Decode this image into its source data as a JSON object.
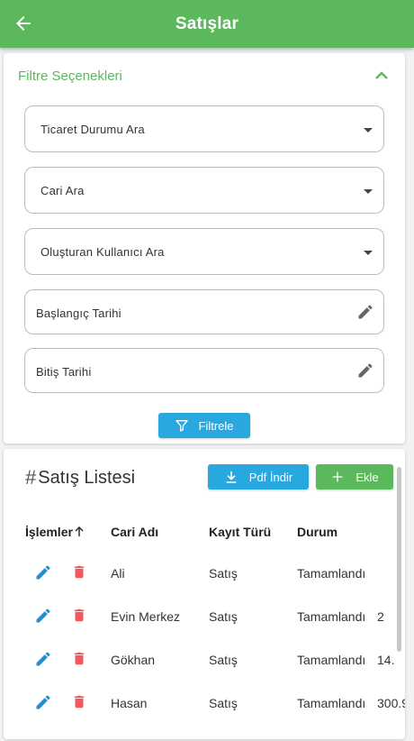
{
  "header": {
    "title": "Satışlar",
    "back_icon": "arrow-left-icon"
  },
  "filter": {
    "title": "Filtre Seçenekleri",
    "trade_status_label": "Ticaret Durumu Ara",
    "account_label": "Cari Ara",
    "created_by_label": "Oluşturan Kullanıcı Ara",
    "start_date_label": "Başlangıç Tarihi",
    "end_date_label": "Bitiş Tarihi",
    "filter_button_label": "Filtrele"
  },
  "list": {
    "hash": "#",
    "title": "Satış Listesi",
    "pdf_button_label": "Pdf İndir",
    "add_button_label": "Ekle",
    "columns": [
      "İşlemler",
      "Cari Adı",
      "Kayıt Türü",
      "Durum"
    ],
    "rows": [
      {
        "name": "Ali",
        "type": "Satış",
        "status": "Tamamlandı",
        "amount": ""
      },
      {
        "name": "Evin  Merkez",
        "type": "Satış",
        "status": "Tamamlandı",
        "amount": "2"
      },
      {
        "name": "Gökhan",
        "type": "Satış",
        "status": "Tamamlandı",
        "amount": "14."
      },
      {
        "name": "Hasan",
        "type": "Satış",
        "status": "Tamamlandı",
        "amount": "300.9"
      }
    ]
  },
  "colors": {
    "primary_green": "#5cb85c",
    "primary_blue": "#29a8e0",
    "edit_blue": "#1e90d6",
    "delete_red": "#f05a5a"
  }
}
